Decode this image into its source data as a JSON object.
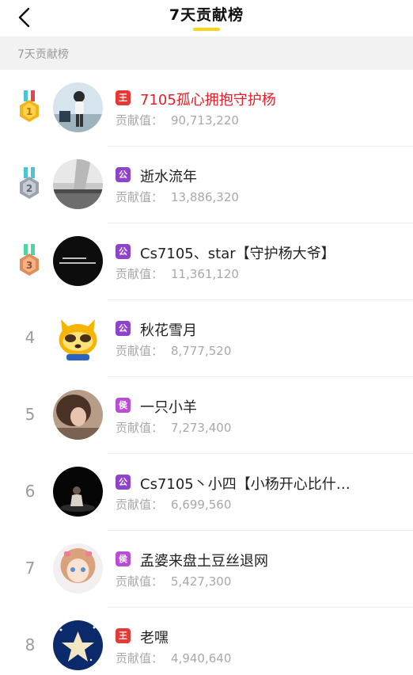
{
  "header": {
    "title": "7天贡献榜"
  },
  "section": {
    "label": "7天贡献榜"
  },
  "contrib_label": "贡献值：",
  "entries": [
    {
      "rank": "1",
      "name": "7105孤心拥抱守护杨",
      "value": "90,713,220",
      "badge": "王",
      "badge_color": "#e53935",
      "medal": "gold",
      "avatar": "girl-photo"
    },
    {
      "rank": "2",
      "name": "逝水流年",
      "value": "13,886,320",
      "badge": "公",
      "badge_color": "#8e44c9",
      "medal": "silver",
      "avatar": "sky-photo"
    },
    {
      "rank": "3",
      "name": "Cs7105、star【守护杨大爷】",
      "value": "11,361,120",
      "badge": "公",
      "badge_color": "#8e44c9",
      "medal": "bronze",
      "avatar": "dark-text"
    },
    {
      "rank": "4",
      "name": "秋花雪月",
      "value": "8,777,520",
      "badge": "公",
      "badge_color": "#8e44c9",
      "medal": "",
      "avatar": "cartoon-raccoon"
    },
    {
      "rank": "5",
      "name": "一只小羊",
      "value": "7,273,400",
      "badge": "侯",
      "badge_color": "#b94dd6",
      "medal": "",
      "avatar": "woman-photo"
    },
    {
      "rank": "6",
      "name": "Cs7105丶小四【小杨开心比什…",
      "value": "6,699,560",
      "badge": "公",
      "badge_color": "#8e44c9",
      "medal": "",
      "avatar": "stage-photo"
    },
    {
      "rank": "7",
      "name": "孟婆来盘土豆丝退网",
      "value": "5,427,300",
      "badge": "侯",
      "badge_color": "#b94dd6",
      "medal": "",
      "avatar": "anime-girl"
    },
    {
      "rank": "8",
      "name": "老嘿",
      "value": "4,940,640",
      "badge": "王",
      "badge_color": "#e53935",
      "medal": "",
      "avatar": "star-toy"
    }
  ],
  "colors": {
    "accent": "#ffd21e",
    "top_name": "#e0202a",
    "muted": "#a8a8a8"
  }
}
